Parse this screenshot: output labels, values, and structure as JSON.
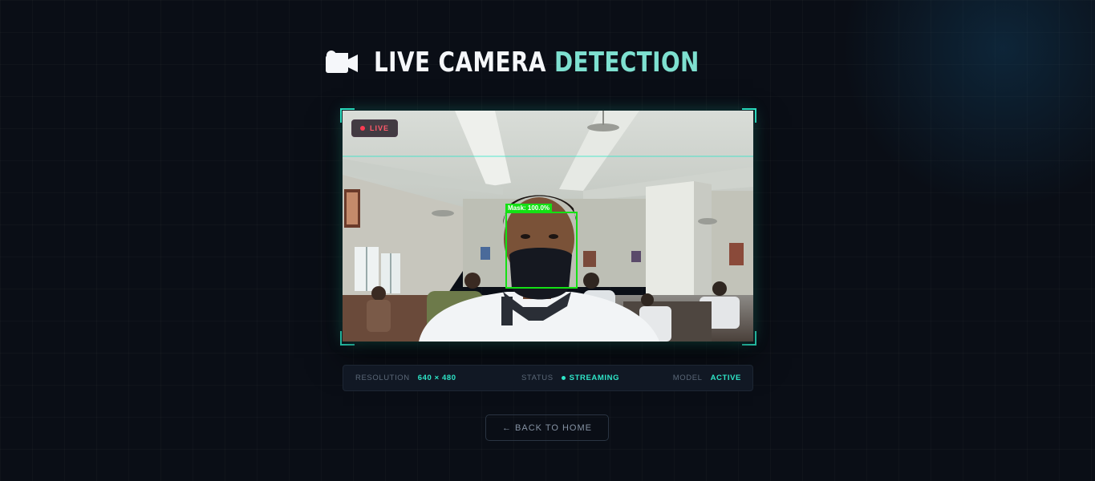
{
  "header": {
    "title_white": "LIVE CAMERA",
    "title_accent": "DETECTION",
    "icon": "video-camera-icon"
  },
  "feed": {
    "live_badge": "LIVE",
    "detection_label": "Mask: 100.0%",
    "detection_color": "#14e014"
  },
  "stats": {
    "resolution_label": "RESOLUTION",
    "resolution_value": "640 × 480",
    "status_label": "STATUS",
    "status_value": "STREAMING",
    "model_label": "MODEL",
    "model_value": "ACTIVE"
  },
  "nav": {
    "back_label": "← BACK TO HOME"
  },
  "colors": {
    "accent": "#2ee6c8",
    "background": "#0a0e16",
    "live_red": "#ff3b52"
  }
}
